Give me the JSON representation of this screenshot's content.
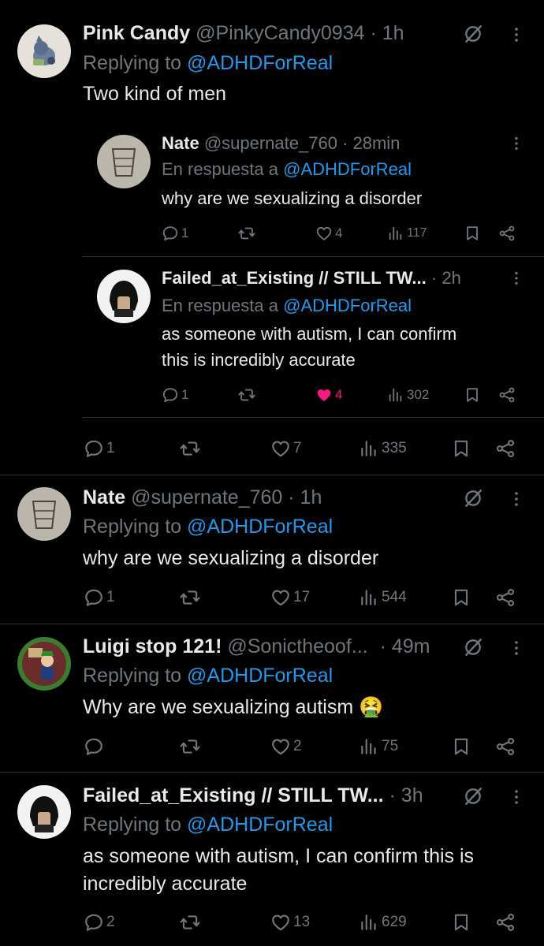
{
  "posts": [
    {
      "author": "Pink Candy",
      "handle": "@PinkyCandy0934",
      "time": "· 1h",
      "replying_prefix": "Replying to",
      "replying_to": "@ADHDForReal",
      "text": "Two kind of men",
      "quoted": [
        {
          "author": "Nate",
          "handle": "@supernate_760",
          "time": "· 28min",
          "replying_prefix": "En respuesta a",
          "replying_to": "@ADHDForReal",
          "text_lines": [
            "why are we sexualizing a disorder"
          ],
          "replies": "1",
          "likes": "4",
          "views": "117",
          "liked": false
        },
        {
          "author": "Failed_at_Existing // STILL TW...",
          "handle": "",
          "time": "· 2h",
          "replying_prefix": "En respuesta a",
          "replying_to": "@ADHDForReal",
          "text_lines": [
            "as someone with autism, I can confirm this is",
            "this is incredibly accurate"
          ],
          "replies": "1",
          "likes": "4",
          "views": "302",
          "liked": true
        }
      ],
      "replies": "1",
      "likes": "7",
      "views": "335"
    },
    {
      "author": "Nate",
      "handle": "@supernate_760",
      "time": "· 1h",
      "replying_prefix": "Replying to",
      "replying_to": "@ADHDForReal",
      "text": "why are we sexualizing a disorder",
      "replies": "1",
      "likes": "17",
      "views": "544"
    },
    {
      "author": "Luigi stop 121!",
      "handle": "@Sonictheoof...",
      "time": "· 49m",
      "replying_prefix": "Replying to",
      "replying_to": "@ADHDForReal",
      "text": "Why are we sexualizing autism",
      "emoji": "🤮",
      "replies": "",
      "likes": "2",
      "views": "75"
    },
    {
      "author": "Failed_at_Existing // STILL TW...",
      "handle": "",
      "time": "· 3h",
      "replying_prefix": "Replying to",
      "replying_to": "@ADHDForReal",
      "text_lines": [
        "as someone with autism, I can confirm this is",
        "incredibly accurate"
      ],
      "replies": "2",
      "likes": "13",
      "views": "629"
    }
  ],
  "colors": {
    "background": "#000000",
    "text": "#e7e9ea",
    "muted": "#71767b",
    "link": "#1d9bf0",
    "like_active": "#f91880",
    "divider": "#2f3336"
  },
  "icons": [
    "reply-icon",
    "repost-icon",
    "like-icon",
    "views-icon",
    "bookmark-icon",
    "share-icon",
    "grok-icon",
    "more-icon"
  ]
}
